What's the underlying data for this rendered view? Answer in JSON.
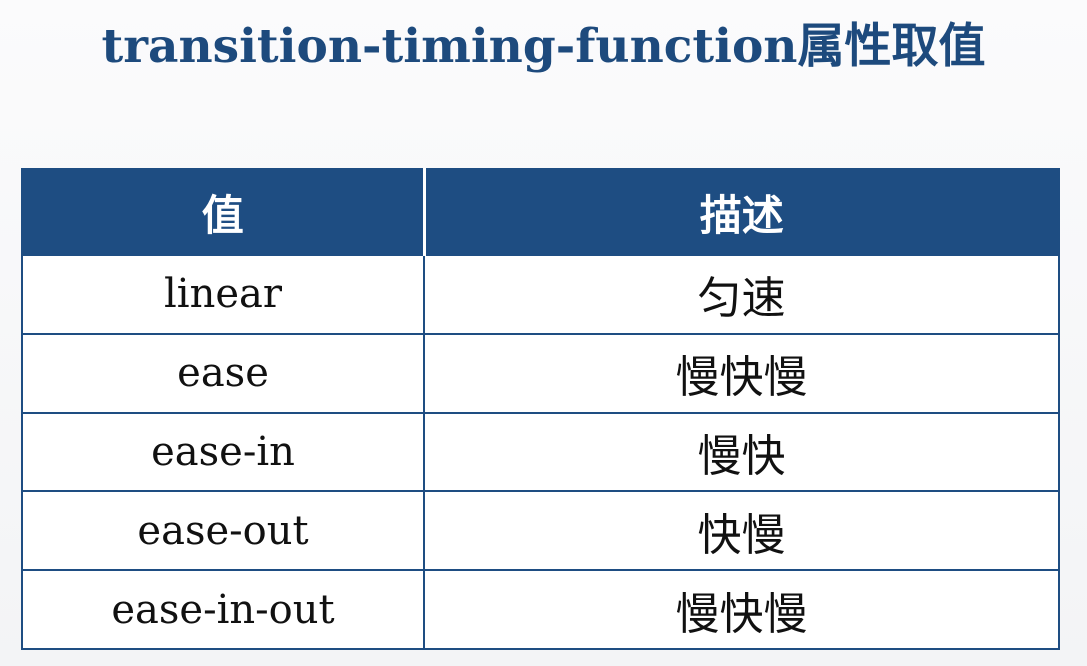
{
  "title": "transition-timing-function属性取值",
  "table": {
    "headers": [
      "值",
      "描述"
    ],
    "rows": [
      {
        "value": "linear",
        "description": "匀速"
      },
      {
        "value": "ease",
        "description": "慢快慢"
      },
      {
        "value": "ease-in",
        "description": "慢快"
      },
      {
        "value": "ease-out",
        "description": "快慢"
      },
      {
        "value": "ease-in-out",
        "description": "慢快慢"
      }
    ]
  },
  "colors": {
    "title": "#1d4a7d",
    "header_bg": "#1e4d82",
    "header_text": "#ffffff",
    "border": "#1e4d82"
  }
}
